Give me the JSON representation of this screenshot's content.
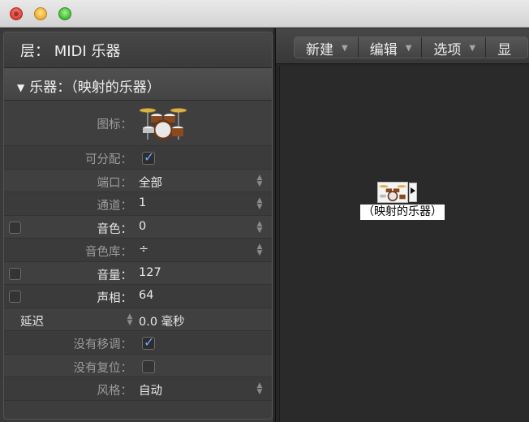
{
  "inspector": {
    "layer_title": "层： MIDI 乐器",
    "section_title": "乐器：（映射的乐器）",
    "rows": {
      "icon_label": "图标：",
      "assignable_label": "可分配：",
      "port_label": "端口：",
      "port_value": "全部",
      "channel_label": "通道：",
      "channel_value": "1",
      "program_label": "音色：",
      "program_value": "0",
      "bank_label": "音色库：",
      "bank_value": "÷",
      "volume_label": "音量：",
      "volume_value": "127",
      "pan_label": "声相：",
      "pan_value": "64",
      "delay_label": "延迟",
      "delay_value": "0.0 毫秒",
      "no_transpose_label": "没有移调：",
      "no_reset_label": "没有复位：",
      "style_label": "风格：",
      "style_value": "自动"
    }
  },
  "toolbar": {
    "new_label": "新建",
    "edit_label": "编辑",
    "options_label": "选项",
    "view_label": "显"
  },
  "canvas": {
    "object_label": "（映射的乐器）"
  },
  "icons": {
    "instrument": "drum-kit-icon",
    "stepper": "stepper-icon",
    "menu_arrow": "chevron-down-icon",
    "disclosure": "disclosure-triangle-icon"
  },
  "colors": {
    "checkmark": "#6aa7ff",
    "background": "#2b2b2b"
  }
}
